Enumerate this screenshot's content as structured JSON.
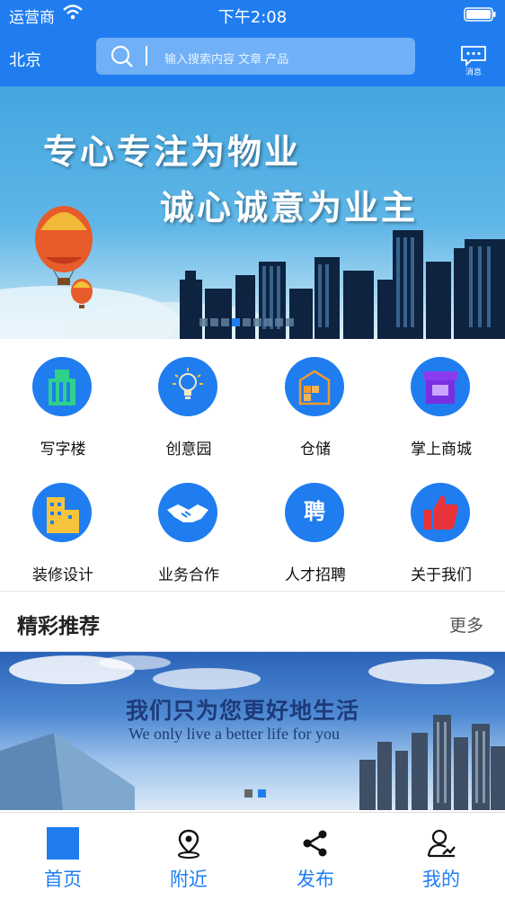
{
  "status_bar": {
    "carrier": "运营商",
    "time": "下午2:08"
  },
  "header": {
    "city": "北京",
    "search_placeholder": "输入搜索内容 文章 产品",
    "message_label": "消息"
  },
  "banner": {
    "line1": "专心专注为物业",
    "line2": "诚心诚意为业主",
    "slide_count": 9,
    "active_slide": 4
  },
  "categories": [
    {
      "label": "写字楼",
      "icon": "office-building-icon"
    },
    {
      "label": "创意园",
      "icon": "lightbulb-icon"
    },
    {
      "label": "仓储",
      "icon": "warehouse-icon"
    },
    {
      "label": "掌上商城",
      "icon": "shop-icon"
    },
    {
      "label": "装修设计",
      "icon": "decoration-building-icon"
    },
    {
      "label": "业务合作",
      "icon": "handshake-icon"
    },
    {
      "label": "人才招聘",
      "icon": "recruit-icon"
    },
    {
      "label": "关于我们",
      "icon": "thumbs-up-icon"
    }
  ],
  "recommend": {
    "title": "精彩推荐",
    "more": "更多"
  },
  "promo": {
    "title": "我们只为您更好地生活",
    "subtitle": "We only live a better life for you",
    "slide_count": 2,
    "active_slide": 2
  },
  "tabs": [
    {
      "label": "首页",
      "icon": "home-icon"
    },
    {
      "label": "附近",
      "icon": "location-pin-icon"
    },
    {
      "label": "发布",
      "icon": "share-icon"
    },
    {
      "label": "我的",
      "icon": "user-icon"
    }
  ],
  "colors": {
    "accent": "#1f7df0",
    "search_bg": "#70b0f6"
  }
}
